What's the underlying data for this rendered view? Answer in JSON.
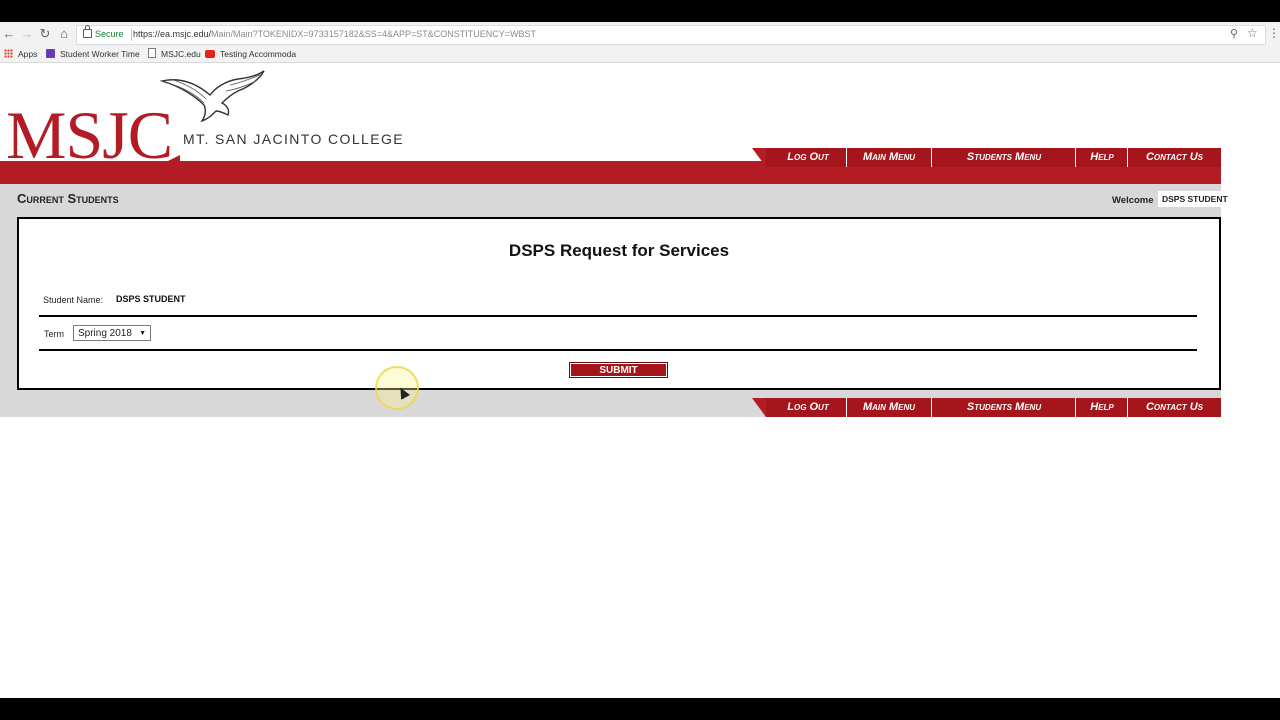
{
  "browser": {
    "secure_label": "Secure",
    "url_host": "https://ea.msjc.edu/",
    "url_path": "Main/Main?TOKENIDX=9733157182&SS=4&APP=ST&CONSTITUENCY=WBST",
    "icons": [
      "back-icon",
      "forward-icon",
      "reload-icon",
      "home-icon",
      "lock-icon",
      "zoom-icon",
      "star-icon",
      "menu-icon"
    ]
  },
  "bookmarks": [
    {
      "label": "Apps",
      "icon": "apps-grid-icon"
    },
    {
      "label": "Student Worker Time",
      "icon": "bookmark-icon"
    },
    {
      "label": "MSJC.edu",
      "icon": "page-icon"
    },
    {
      "label": "Testing Accommoda",
      "icon": "youtube-icon"
    }
  ],
  "header": {
    "logo_text": "MSJC",
    "college_name": "MT. SAN JACINTO COLLEGE",
    "brand_color": "#b31c24"
  },
  "nav": {
    "items": [
      "Log Out",
      "Main Menu",
      "Students Menu",
      "Help",
      "Contact Us"
    ]
  },
  "section": {
    "title": "Current Students",
    "welcome_label": "Welcome",
    "welcome_name": "DSPS STUDENT"
  },
  "form": {
    "title": "DSPS Request for Services",
    "student_name_label": "Student Name:",
    "student_name_value": "DSPS STUDENT",
    "term_label": "Term",
    "term_value": "Spring 2018",
    "submit_label": "SUBMIT"
  }
}
